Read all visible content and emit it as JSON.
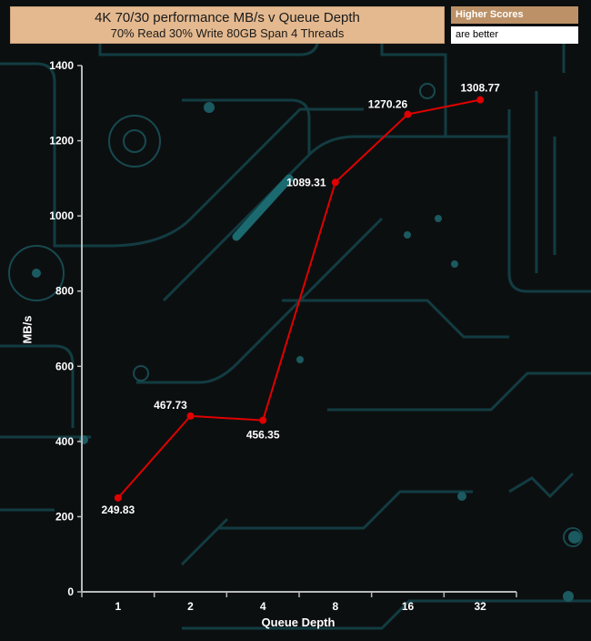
{
  "chart_data": {
    "type": "line",
    "title": "4K 70/30 performance MB/s v Queue Depth",
    "subtitle": "70% Read 30% Write 80GB Span 4 Threads",
    "xlabel": "Queue Depth",
    "ylabel": "MB/s",
    "categories": [
      "1",
      "2",
      "4",
      "8",
      "16",
      "32"
    ],
    "series": [
      {
        "values": [
          249.83,
          467.73,
          456.35,
          1089.31,
          1270.26,
          1308.77
        ],
        "color": "#e00000"
      }
    ],
    "ylim": [
      0,
      1400
    ],
    "yticks": [
      0,
      200,
      400,
      600,
      800,
      1000,
      1200,
      1400
    ],
    "data_labels": [
      "249.83",
      "467.73",
      "456.35",
      "1089.31",
      "1270.26",
      "1308.77"
    ],
    "grid": false
  },
  "legend_note": {
    "line1": "Higher Scores",
    "line2": "are better"
  },
  "colors": {
    "background": "#0c0f10",
    "circuit": "#123c42",
    "title_box": "#e4b98f",
    "badge": "#bc9167",
    "axis": "#b8b8b8",
    "line": "#e00000",
    "text": "#ffffff"
  }
}
